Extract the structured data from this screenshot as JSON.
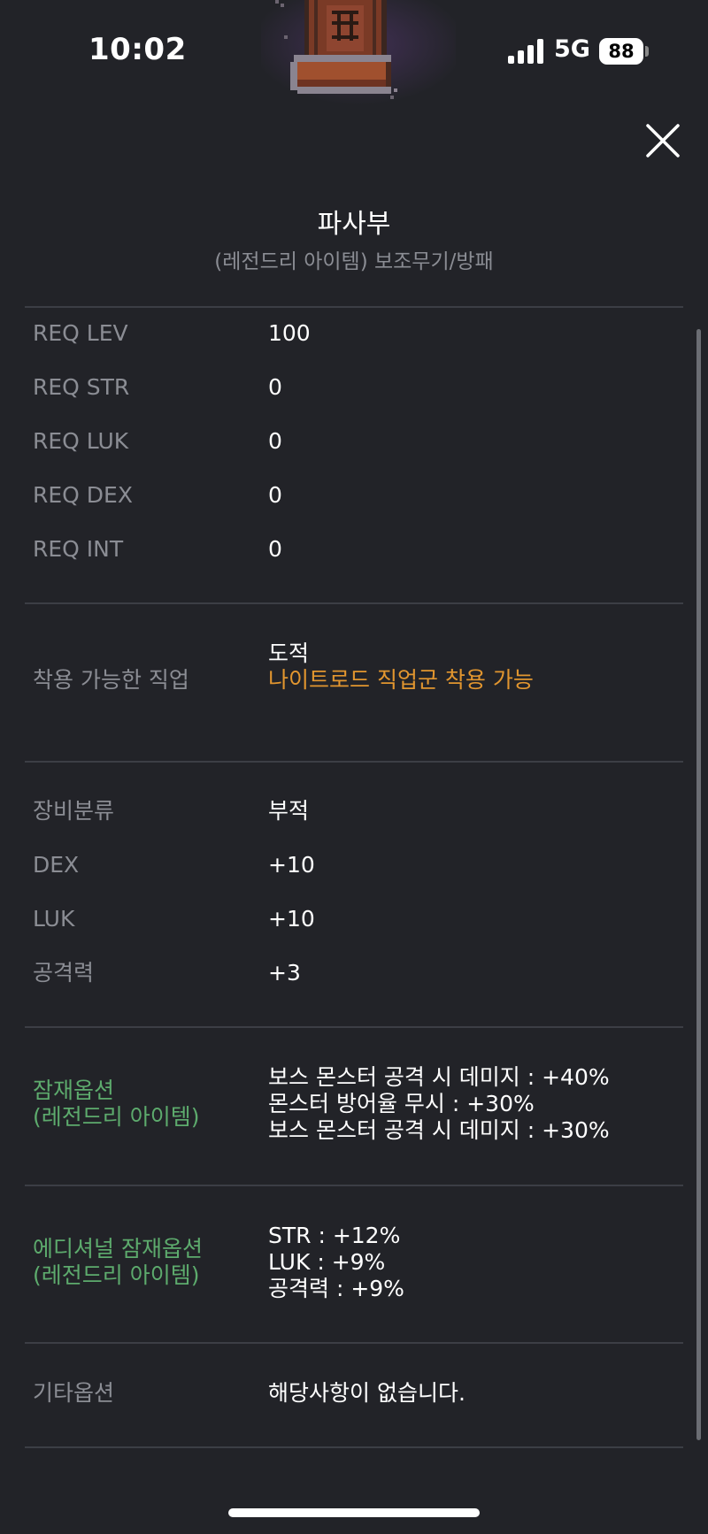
{
  "status_bar": {
    "time": "10:02",
    "network": "5G",
    "battery": "88"
  },
  "item": {
    "name": "파사부",
    "subtitle": "(레전드리 아이템) 보조무기/방패"
  },
  "requirements": [
    {
      "label": "REQ LEV",
      "value": "100"
    },
    {
      "label": "REQ STR",
      "value": "0"
    },
    {
      "label": "REQ LUK",
      "value": "0"
    },
    {
      "label": "REQ DEX",
      "value": "0"
    },
    {
      "label": "REQ INT",
      "value": "0"
    }
  ],
  "job": {
    "label": "착용 가능한 직업",
    "value": "도적",
    "note": "나이트로드 직업군 착용 가능"
  },
  "stats": [
    {
      "label": "장비분류",
      "value": "부적"
    },
    {
      "label": "DEX",
      "value": "+10"
    },
    {
      "label": "LUK",
      "value": "+10"
    },
    {
      "label": "공격력",
      "value": "+3"
    }
  ],
  "potential": {
    "label_line1": "잠재옵션",
    "label_line2": "(레전드리 아이템)",
    "lines": [
      "보스 몬스터 공격 시 데미지 : +40%",
      "몬스터 방어율 무시 : +30%",
      "보스 몬스터 공격 시 데미지 : +30%"
    ]
  },
  "additional_potential": {
    "label_line1": "에디셔널 잠재옵션",
    "label_line2": "(레전드리 아이템)",
    "lines": [
      "STR : +12%",
      "LUK : +9%",
      "공격력 : +9%"
    ]
  },
  "etc": {
    "label": "기타옵션",
    "value": "해당사항이 없습니다."
  },
  "colors": {
    "background": "#222328",
    "label_gray": "#8b8d94",
    "potential_green": "#5dab6d",
    "job_orange": "#e2962f"
  }
}
